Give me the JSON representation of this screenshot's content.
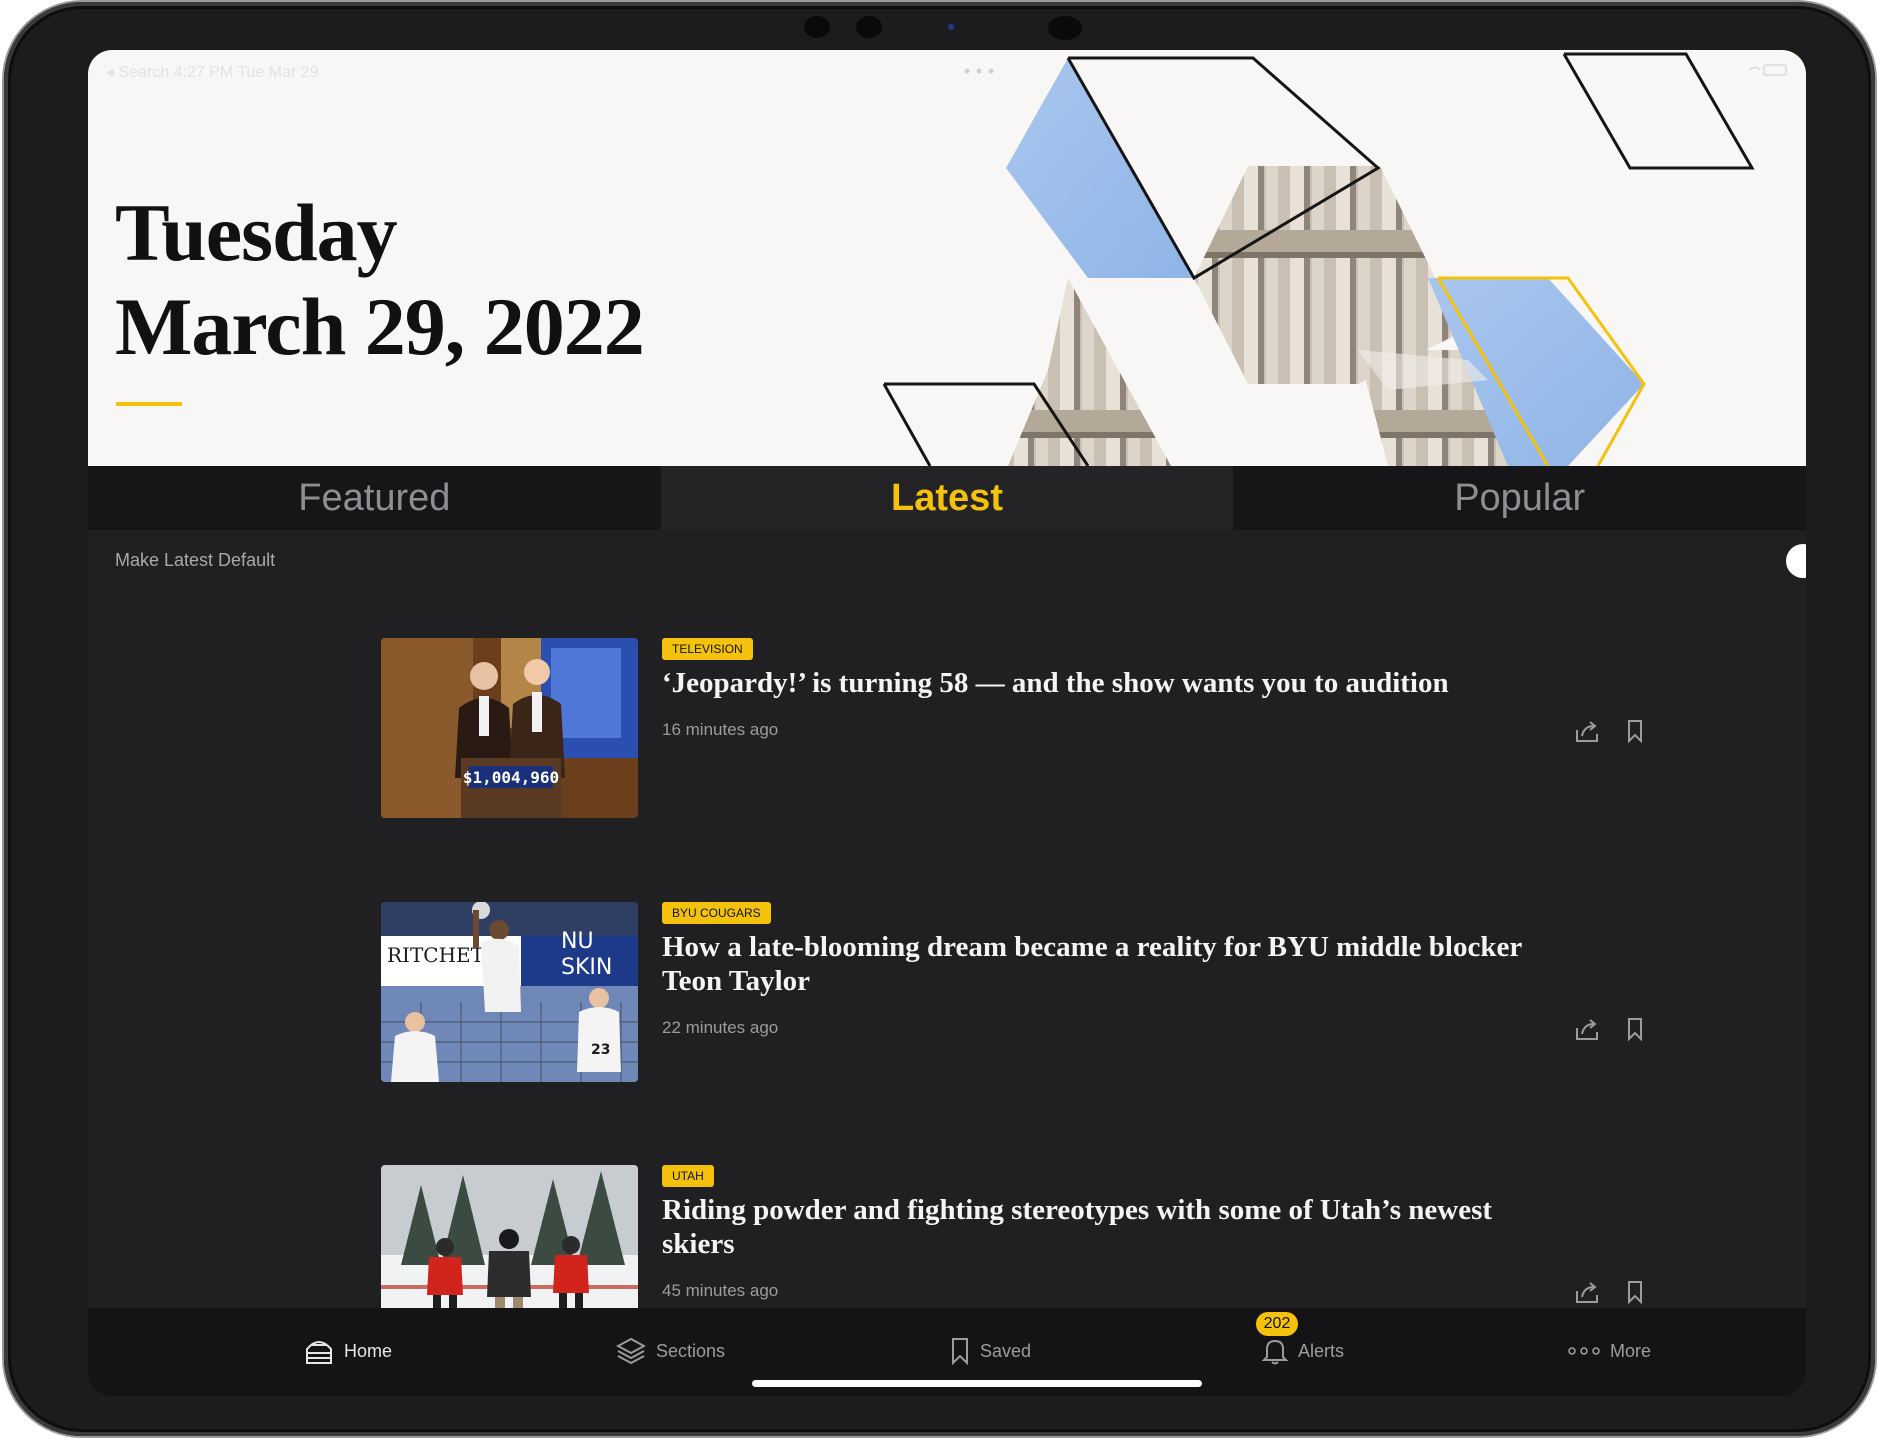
{
  "status_bar": {
    "left": "◂ Search  4:27 PM  Tue Mar 29"
  },
  "header": {
    "day": "Tuesday",
    "date": "March 29, 2022"
  },
  "tabs": [
    {
      "label": "Featured",
      "active": false
    },
    {
      "label": "Latest",
      "active": true
    },
    {
      "label": "Popular",
      "active": false
    }
  ],
  "default_toggle": {
    "label": "Make Latest Default",
    "on": false
  },
  "articles": [
    {
      "category": "TELEVISION",
      "headline": "‘Jeopardy!’ is turning 58 — and the show wants you to audition",
      "time": "16 minutes ago",
      "image_text": "$1,004,960"
    },
    {
      "category": "BYU COUGARS",
      "headline": "How a late-blooming dream became a reality for BYU middle blocker Teon Taylor",
      "time": "22 minutes ago",
      "image_text": [
        "RITCHETT",
        "NU",
        "SKIN",
        "23"
      ]
    },
    {
      "category": "UTAH",
      "headline": "Riding powder and fighting stereotypes with some of Utah’s newest skiers",
      "time": "45 minutes ago"
    }
  ],
  "tabbar": [
    {
      "label": "Home",
      "icon": "home-icon",
      "active": true
    },
    {
      "label": "Sections",
      "icon": "layers-icon",
      "active": false
    },
    {
      "label": "Saved",
      "icon": "bookmark-icon",
      "active": false
    },
    {
      "label": "Alerts",
      "icon": "bell-icon",
      "active": false,
      "badge": "202"
    },
    {
      "label": "More",
      "icon": "more-icon",
      "active": false
    }
  ],
  "colors": {
    "accent": "#f4c20d",
    "background": "#202022",
    "header_bg": "#f8f7f5"
  }
}
